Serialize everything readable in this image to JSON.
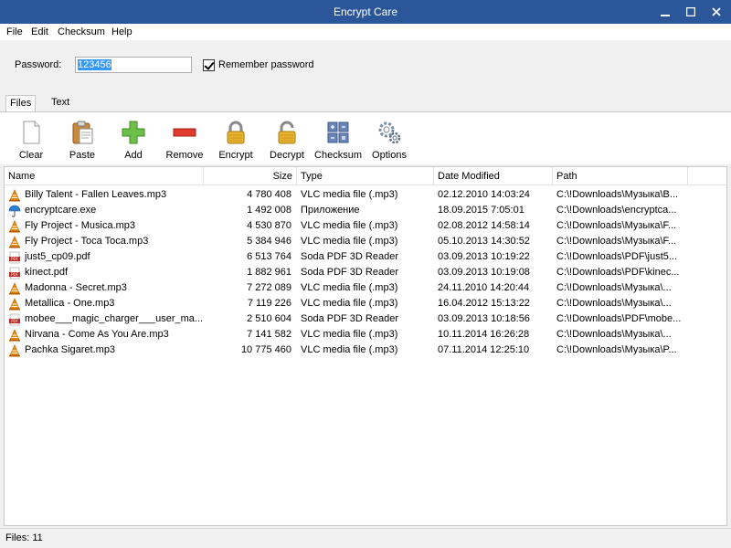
{
  "window": {
    "title": "Encrypt Care"
  },
  "menu": {
    "file": "File",
    "edit": "Edit",
    "checksum": "Checksum",
    "help": "Help"
  },
  "password": {
    "label": "Password:",
    "value": "123456"
  },
  "remember": {
    "label": "Remember password",
    "checked": true
  },
  "tabs": {
    "files": "Files",
    "text": "Text"
  },
  "toolbar": {
    "clear": "Clear",
    "paste": "Paste",
    "add": "Add",
    "remove": "Remove",
    "encrypt": "Encrypt",
    "decrypt": "Decrypt",
    "checksum": "Checksum",
    "options": "Options"
  },
  "columns": {
    "name": "Name",
    "size": "Size",
    "type": "Type",
    "date": "Date Modified",
    "path": "Path"
  },
  "files": [
    {
      "icon": "vlc-icon",
      "name": "Billy Talent - Fallen Leaves.mp3",
      "size": "4 780 408",
      "type": "VLC media file (.mp3)",
      "date": "02.12.2010 14:03:24",
      "path": "C:\\!Downloads\\Музыка\\B..."
    },
    {
      "icon": "umbrella-icon",
      "name": "encryptcare.exe",
      "size": "1 492 008",
      "type": "Приложение",
      "date": "18.09.2015 7:05:01",
      "path": "C:\\!Downloads\\encryptca..."
    },
    {
      "icon": "vlc-icon",
      "name": "Fly Project - Musica.mp3",
      "size": "4 530 870",
      "type": "VLC media file (.mp3)",
      "date": "02.08.2012 14:58:14",
      "path": "C:\\!Downloads\\Музыка\\F..."
    },
    {
      "icon": "vlc-icon",
      "name": "Fly Project - Toca Toca.mp3",
      "size": "5 384 946",
      "type": "VLC media file (.mp3)",
      "date": "05.10.2013 14:30:52",
      "path": "C:\\!Downloads\\Музыка\\F..."
    },
    {
      "icon": "pdf-icon",
      "name": "just5_cp09.pdf",
      "size": "6 513 764",
      "type": "Soda PDF 3D Reader",
      "date": "03.09.2013 10:19:22",
      "path": "C:\\!Downloads\\PDF\\just5..."
    },
    {
      "icon": "pdf-icon",
      "name": "kinect.pdf",
      "size": "1 882 961",
      "type": "Soda PDF 3D Reader",
      "date": "03.09.2013 10:19:08",
      "path": "C:\\!Downloads\\PDF\\kinec..."
    },
    {
      "icon": "vlc-icon",
      "name": "Madonna - Secret.mp3",
      "size": "7 272 089",
      "type": "VLC media file (.mp3)",
      "date": "24.11.2010 14:20:44",
      "path": "C:\\!Downloads\\Музыка\\..."
    },
    {
      "icon": "vlc-icon",
      "name": "Metallica - One.mp3",
      "size": "7 119 226",
      "type": "VLC media file (.mp3)",
      "date": "16.04.2012 15:13:22",
      "path": "C:\\!Downloads\\Музыка\\..."
    },
    {
      "icon": "pdf-icon",
      "name": "mobee___magic_charger___user_ma...",
      "size": "2 510 604",
      "type": "Soda PDF 3D Reader",
      "date": "03.09.2013 10:18:56",
      "path": "C:\\!Downloads\\PDF\\mobe..."
    },
    {
      "icon": "vlc-icon",
      "name": "Nirvana - Come As You Are.mp3",
      "size": "7 141 582",
      "type": "VLC media file (.mp3)",
      "date": "10.11.2014 16:26:28",
      "path": "C:\\!Downloads\\Музыка\\..."
    },
    {
      "icon": "vlc-icon",
      "name": "Pachka Sigaret.mp3",
      "size": "10 775 460",
      "type": "VLC media file (.mp3)",
      "date": "07.11.2014 12:25:10",
      "path": "C:\\!Downloads\\Музыка\\P..."
    }
  ],
  "status": {
    "text": "Files: 11"
  },
  "colors": {
    "titlebar": "#2b579a",
    "add": "#6cc04a",
    "remove": "#e23b2e",
    "vlc": "#f08a00",
    "pdf": "#c0281c"
  }
}
